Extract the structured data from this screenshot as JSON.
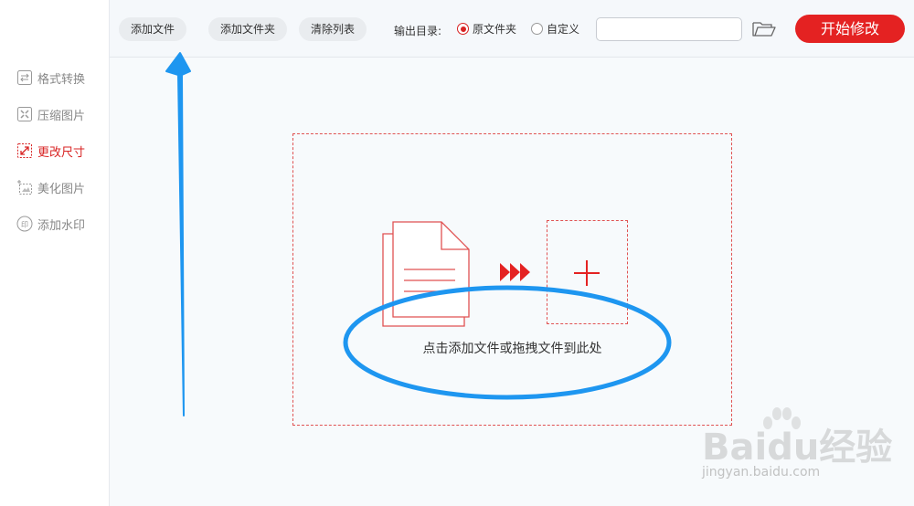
{
  "sidebar": {
    "items": [
      {
        "label": "格式转换",
        "icon": "convert-icon"
      },
      {
        "label": "压缩图片",
        "icon": "compress-icon"
      },
      {
        "label": "更改尺寸",
        "icon": "resize-icon",
        "active": true
      },
      {
        "label": "美化图片",
        "icon": "beautify-icon"
      },
      {
        "label": "添加水印",
        "icon": "watermark-icon"
      }
    ]
  },
  "toolbar": {
    "add_file": "添加文件",
    "add_folder": "添加文件夹",
    "clear_list": "清除列表",
    "output_label": "输出目录:",
    "radio_original": "原文件夹",
    "radio_custom": "自定义",
    "selected_output": "原文件夹",
    "path_value": "",
    "start_button": "开始修改"
  },
  "dropzone": {
    "hint": "点击添加文件或拖拽文件到此处"
  },
  "watermark": {
    "brand": "Baidu经验",
    "url": "jingyan.baidu.com"
  },
  "colors": {
    "accent": "#e42222",
    "annotation": "#1e96f0",
    "active_text": "#d82323"
  }
}
